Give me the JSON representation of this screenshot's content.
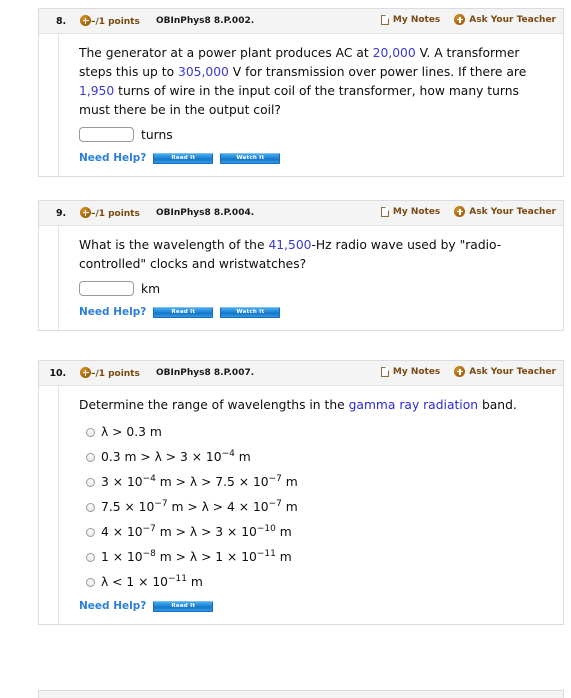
{
  "tools": {
    "my_notes": "My Notes",
    "ask_teacher": "Ask Your Teacher",
    "notes_icon": "document-icon",
    "ask_icon": "plus-circle-icon"
  },
  "help": {
    "label": "Need Help?",
    "read_it": "Read It",
    "watch_it": "Watch It"
  },
  "colors": {
    "link": "#2b2bd6",
    "highlight": "#3a3ad0",
    "points_text": "#7a4a12",
    "help_label": "#2b7fd4",
    "button_blue": "#1c84d6",
    "header_bg": "#f4f4f4",
    "card_border": "#dcdcdc"
  },
  "questions": [
    {
      "number": "8.",
      "points": "–/1",
      "points_label": "points",
      "code": "OBInPhys8 8.P.002.",
      "text_parts": [
        {
          "t": "The generator at a power plant produces AC at ",
          "style": "plain"
        },
        {
          "t": "20,000",
          "style": "highlight"
        },
        {
          "t": " V. A transformer steps this up to ",
          "style": "plain"
        },
        {
          "t": "305,000",
          "style": "highlight"
        },
        {
          "t": " V for transmission over power lines. If there are ",
          "style": "plain"
        },
        {
          "t": "1,950",
          "style": "highlight"
        },
        {
          "t": " turns of wire in the input coil of the transformer, how many turns must there be in the output coil?",
          "style": "plain"
        }
      ],
      "answer": {
        "value": "",
        "placeholder": "",
        "unit": "turns"
      },
      "help_buttons": [
        "Read It",
        "Watch It"
      ],
      "options": []
    },
    {
      "number": "9.",
      "points": "–/1",
      "points_label": "points",
      "code": "OBInPhys8 8.P.004.",
      "text_parts": [
        {
          "t": "What is the wavelength of the ",
          "style": "plain"
        },
        {
          "t": "41,500",
          "style": "highlight"
        },
        {
          "t": "-Hz radio wave used by \"radio-controlled\" clocks and wristwatches?",
          "style": "plain"
        }
      ],
      "answer": {
        "value": "",
        "placeholder": "",
        "unit": "km"
      },
      "help_buttons": [
        "Read It",
        "Watch It"
      ],
      "options": []
    },
    {
      "number": "10.",
      "points": "–/1",
      "points_label": "points",
      "code": "OBInPhys8 8.P.007.",
      "text_parts": [
        {
          "t": "Determine the range of wavelengths in the ",
          "style": "plain"
        },
        {
          "t": "gamma ray radiation",
          "style": "link"
        },
        {
          "t": " band.",
          "style": "plain"
        }
      ],
      "answer": null,
      "help_buttons": [
        "Read It"
      ],
      "options": [
        {
          "html": "λ > 0.3 m",
          "selected": false
        },
        {
          "html": "0.3 m > λ > 3 × 10<sup>−4</sup> m",
          "selected": false
        },
        {
          "html": "3 × 10<sup>−4</sup> m > λ > 7.5 × 10<sup>−7</sup> m",
          "selected": false
        },
        {
          "html": "7.5 × 10<sup>−7</sup> m > λ > 4 × 10<sup>−7</sup> m",
          "selected": false
        },
        {
          "html": "4 × 10<sup>−7</sup> m > λ > 3 × 10<sup>−10</sup> m",
          "selected": false
        },
        {
          "html": "1 × 10<sup>−8</sup> m > λ > 1 × 10<sup>−11</sup> m",
          "selected": false
        },
        {
          "html": "λ < 1 × 10<sup>−11</sup> m",
          "selected": false
        }
      ]
    }
  ]
}
